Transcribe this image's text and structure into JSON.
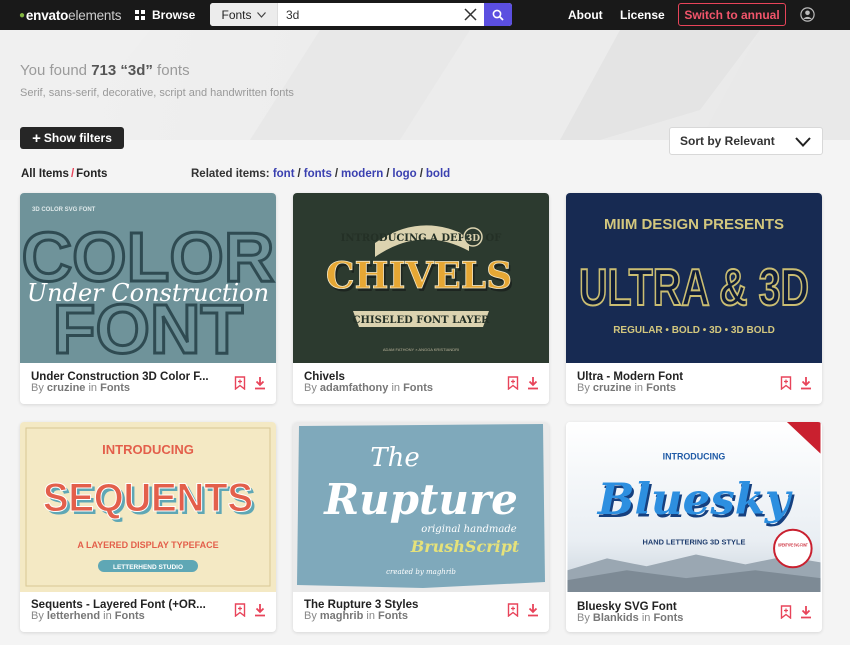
{
  "topbar": {
    "logo_brand": "envato",
    "logo_product": "elements",
    "browse_label": "Browse",
    "search_category": "Fonts",
    "search_value": "3d",
    "about_label": "About",
    "license_label": "License",
    "switch_label": "Switch to annual"
  },
  "results": {
    "prefix": "You found ",
    "count_text": "713 “3d”",
    "suffix": " fonts",
    "subtitle": "Serif, sans-serif, decorative, script and handwritten fonts"
  },
  "filters": {
    "show_filters_label": "Show filters"
  },
  "sort": {
    "label": "Sort by Relevant"
  },
  "breadcrumb": {
    "all_items": "All Items",
    "separator": "/",
    "current": "Fonts"
  },
  "related": {
    "label": "Related items:",
    "tags": [
      "font",
      "fonts",
      "modern",
      "logo",
      "bold"
    ]
  },
  "colors": {
    "accent": "#e8445a",
    "search_button": "#5b4fe0",
    "topbar": "#191919",
    "link": "#3a40b0"
  },
  "cards": [
    {
      "title": "Under Construction 3D Color F...",
      "author": "cruzine",
      "in_text": "in",
      "category": "Fonts",
      "art": {
        "heading": "3D COLOR SVG FONT",
        "line1": "COLOR",
        "line2": "FONT",
        "script": "Under Construction"
      }
    },
    {
      "title": "Chivels",
      "author": "adamfathony",
      "in_text": "in",
      "category": "Fonts",
      "art": {
        "top": "INTRODUCING A DEPTH OF",
        "badge": "3D",
        "main": "CHIVELS",
        "bottom": "CHISELED FONT LAYER",
        "credit": "ADAM FATHONY × ANGGA KRISTIANDRI"
      }
    },
    {
      "title": "Ultra - Modern Font",
      "author": "cruzine",
      "in_text": "in",
      "category": "Fonts",
      "art": {
        "top": "MIIM DESIGN PRESENTS",
        "main": "ULTRA & 3D",
        "bottom": "REGULAR • BOLD • 3D • 3D BOLD"
      }
    },
    {
      "title": "Sequents - Layered Font (+OR...",
      "author": "letterhend",
      "in_text": "in",
      "category": "Fonts",
      "art": {
        "top": "INTRODUCING",
        "main": "SEQUENTS",
        "sub": "A LAYERED DISPLAY TYPEFACE",
        "studio": "LETTERHEND STUDIO"
      }
    },
    {
      "title": "The Rupture 3 Styles",
      "author": "maghrib",
      "in_text": "in",
      "category": "Fonts",
      "art": {
        "line1": "The",
        "line2": "Rupture",
        "sub": "original handmade",
        "brush": "BrushScript",
        "credit": "created by maghrib"
      }
    },
    {
      "title": "Bluesky SVG Font",
      "author": "Blankids",
      "in_text": "in",
      "category": "Fonts",
      "art": {
        "top": "INTRODUCING",
        "main": "Bluesky",
        "sub": "HAND LETTERING 3D STYLE",
        "badge": "OPENTYPE SVG FONT"
      }
    }
  ]
}
